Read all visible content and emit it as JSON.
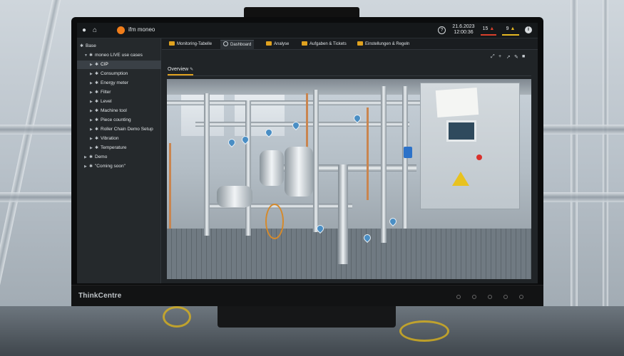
{
  "app": {
    "title": "ifm moneo"
  },
  "monitor": {
    "brand": "ThinkCentre"
  },
  "topbar": {
    "user_icon": "user-icon",
    "home_icon": "home-icon",
    "date": "21.6.2023",
    "time": "12:00:36",
    "alarm_count": "15",
    "warning_count": "9",
    "colors": {
      "alarm": "#d9402b",
      "warning": "#e6b822",
      "accent": "#e0a21f"
    }
  },
  "sidebar": {
    "root": "Base",
    "group": "moneo LIVE use cases",
    "items": [
      {
        "label": "CIP",
        "selected": true
      },
      {
        "label": "Consumption"
      },
      {
        "label": "Energy meter"
      },
      {
        "label": "Filter"
      },
      {
        "label": "Level"
      },
      {
        "label": "Machine tool"
      },
      {
        "label": "Piece counting"
      },
      {
        "label": "Roller Chain Demo Setup"
      },
      {
        "label": "Vibration"
      },
      {
        "label": "Temperature"
      }
    ],
    "demo": "Demo",
    "coming_soon": "\"Coming soon\""
  },
  "tabs": [
    {
      "label": "Monitoring-Tabelle",
      "icon": "table-icon",
      "color": "#e0a21f"
    },
    {
      "label": "Dashboard",
      "icon": "gauge-icon",
      "color": "#c8ced3",
      "active": true
    },
    {
      "label": "Analyse",
      "icon": "chart-icon",
      "color": "#e0a21f"
    },
    {
      "label": "Aufgaben & Tickets",
      "icon": "tasks-icon",
      "color": "#e0a21f"
    },
    {
      "label": "Einstellungen & Regeln",
      "icon": "settings-icon",
      "color": "#e0a21f"
    }
  ],
  "toolbar": {
    "icons": [
      "fullscreen-icon",
      "add-icon",
      "pin-icon",
      "edit-icon",
      "delete-icon"
    ]
  },
  "dashboard": {
    "overview_tab": "Overview"
  }
}
